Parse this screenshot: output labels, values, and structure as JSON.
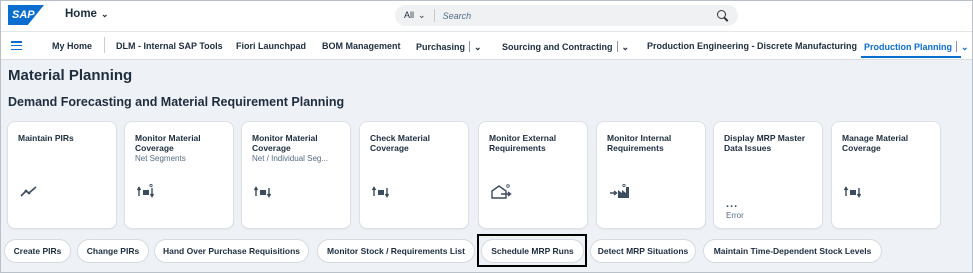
{
  "shell": {
    "logo_text": "SAP",
    "home_title": "Home",
    "search_scope": "All",
    "search_placeholder": "Search"
  },
  "nav": {
    "items": [
      {
        "label": "My Home"
      },
      {
        "label": "DLM - Internal SAP Tools"
      },
      {
        "label": "Fiori Launchpad"
      },
      {
        "label": "BOM Management"
      },
      {
        "label": "Purchasing"
      },
      {
        "label": "Sourcing and Contracting"
      },
      {
        "label": "Production Engineering - Discrete Manufacturing"
      },
      {
        "label": "Production Planning"
      }
    ],
    "active": "Production Planning",
    "accent_color": "#0a6ed1"
  },
  "page": {
    "title": "Material Planning",
    "section_title": "Demand Forecasting and Material Requirement Planning"
  },
  "tiles": [
    {
      "title": "Maintain PIRs",
      "subtitle": "",
      "icon": "trend-chart-icon"
    },
    {
      "title": "Monitor Material Coverage",
      "subtitle": "Net Segments",
      "icon": "material-coverage-icon"
    },
    {
      "title": "Monitor Material Coverage",
      "subtitle": "Net / Individual Seg...",
      "icon": "material-coverage-icon"
    },
    {
      "title": "Check Material Coverage",
      "subtitle": "",
      "icon": "material-coverage-icon"
    },
    {
      "title": "Monitor External Requirements",
      "subtitle": "",
      "icon": "warehouse-icon"
    },
    {
      "title": "Monitor Internal Requirements",
      "subtitle": "",
      "icon": "factory-icon"
    },
    {
      "title": "Display MRP Master Data Issues",
      "subtitle": "",
      "value": "...",
      "footer": "Error"
    },
    {
      "title": "Manage Material Coverage",
      "subtitle": "",
      "icon": "material-coverage-icon"
    }
  ],
  "links": [
    {
      "label": "Create PIRs"
    },
    {
      "label": "Change PIRs"
    },
    {
      "label": "Hand Over Purchase Requisitions"
    },
    {
      "label": "Monitor Stock / Requirements List"
    },
    {
      "label": "Schedule MRP Runs"
    },
    {
      "label": "Detect MRP Situations"
    },
    {
      "label": "Maintain Time-Dependent Stock Levels"
    }
  ],
  "highlighted_link": "Schedule MRP Runs"
}
